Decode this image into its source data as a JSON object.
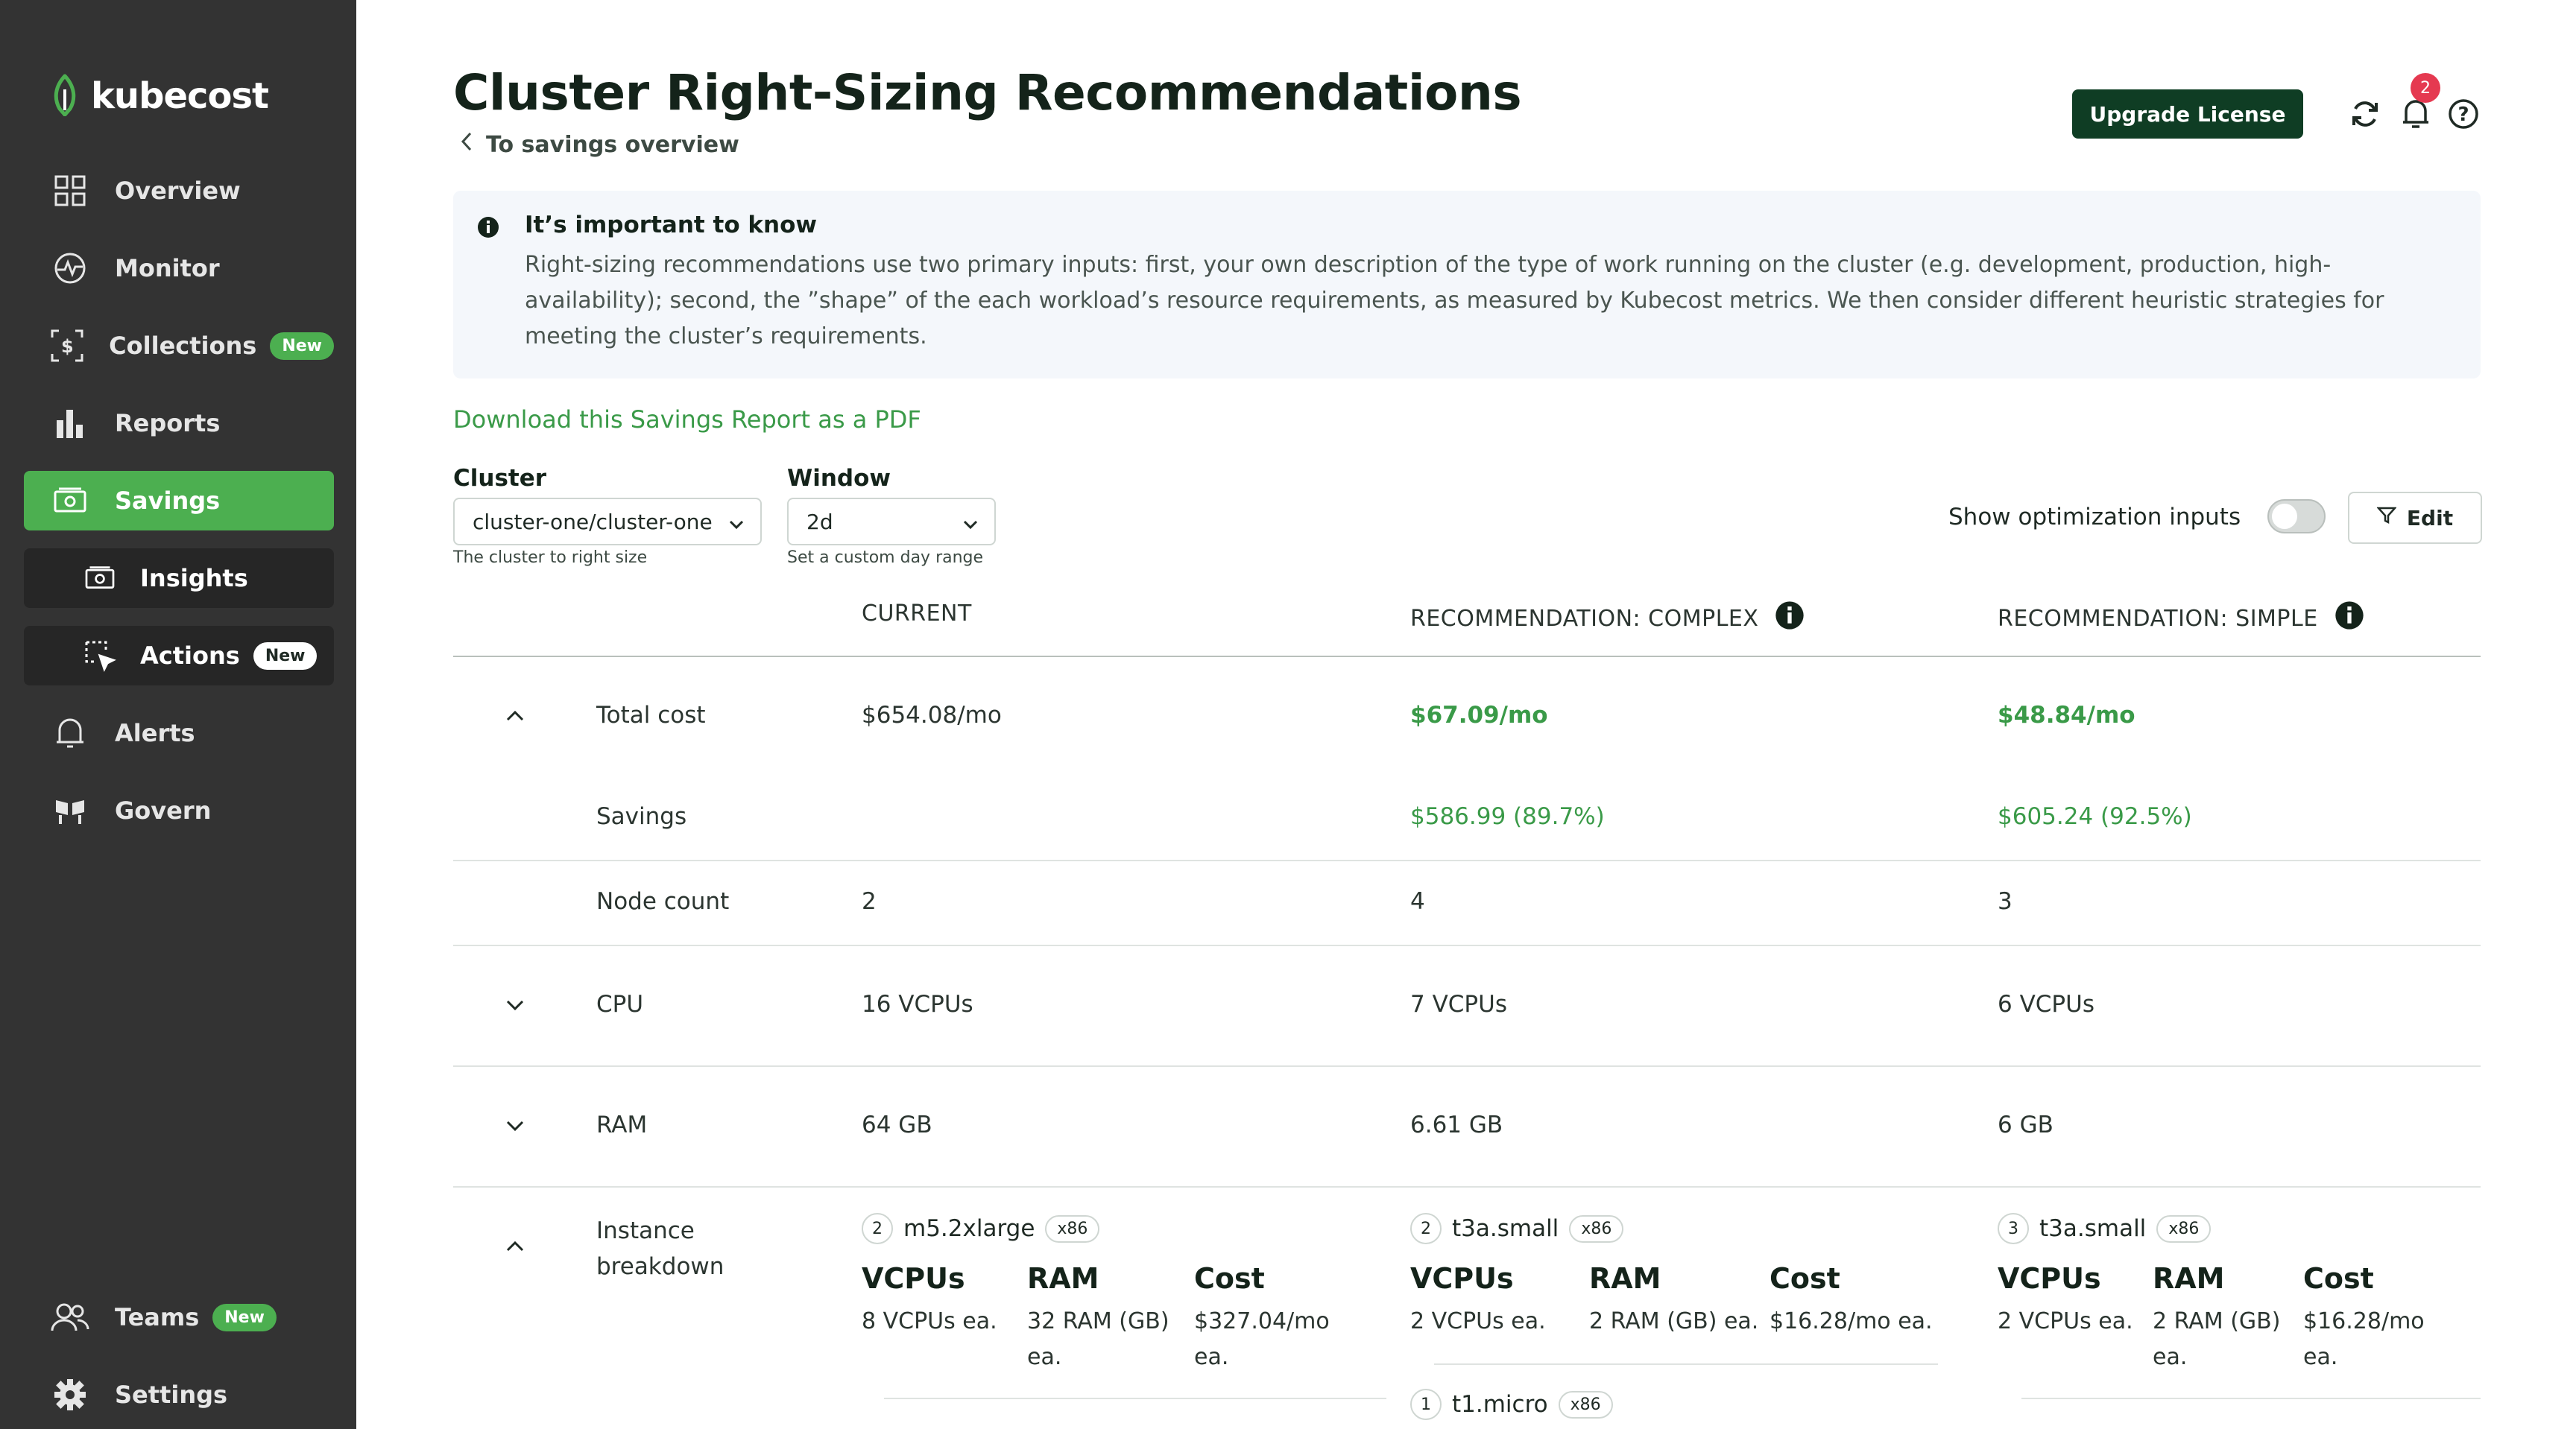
{
  "app": {
    "logo_text": "kubecost"
  },
  "sidebar": {
    "items": [
      {
        "label": "Overview"
      },
      {
        "label": "Monitor"
      },
      {
        "label": "Collections",
        "badge": "New"
      },
      {
        "label": "Reports"
      },
      {
        "label": "Savings",
        "active": true
      },
      {
        "label": "Insights"
      },
      {
        "label": "Actions",
        "badge": "New"
      },
      {
        "label": "Alerts"
      },
      {
        "label": "Govern"
      },
      {
        "label": "Teams",
        "badge": "New"
      },
      {
        "label": "Settings"
      }
    ]
  },
  "header": {
    "title": "Cluster Right-Sizing Recommendations",
    "back_label": "To savings overview",
    "upgrade_label": "Upgrade License",
    "notification_count": "2"
  },
  "info": {
    "title": "It’s important to know",
    "body": "Right-sizing recommendations use two primary inputs: first, your own description of the type of work running on the cluster (e.g. development, production, high-availability); second, the ”shape” of the each workload’s resource requirements, as measured by Kubecost metrics. We then consider different heuristic strategies for meeting the cluster’s requirements."
  },
  "download_label": "Download this Savings Report as a PDF",
  "filters": {
    "cluster": {
      "label": "Cluster",
      "value": "cluster-one/cluster-one",
      "help": "The cluster to right size"
    },
    "window": {
      "label": "Window",
      "value": "2d",
      "help": "Set a custom day range"
    },
    "optimization_label": "Show optimization inputs",
    "edit_label": "Edit"
  },
  "table": {
    "columns": [
      "CURRENT",
      "RECOMMENDATION: COMPLEX",
      "RECOMMENDATION: SIMPLE"
    ],
    "rows": {
      "total_cost": {
        "label": "Total cost",
        "current": "$654.08/mo",
        "complex": "$67.09/mo",
        "simple": "$48.84/mo"
      },
      "savings": {
        "label": "Savings",
        "current": "",
        "complex": "$586.99 (89.7%)",
        "simple": "$605.24 (92.5%)"
      },
      "node_count": {
        "label": "Node count",
        "current": "2",
        "complex": "4",
        "simple": "3"
      },
      "cpu": {
        "label": "CPU",
        "current": "16 VCPUs",
        "complex": "7 VCPUs",
        "simple": "6 VCPUs"
      },
      "ram": {
        "label": "RAM",
        "current": "64 GB",
        "complex": "6.61 GB",
        "simple": "6 GB"
      },
      "instance": {
        "label": "Instance breakdown"
      }
    },
    "spec_headers": {
      "vcpus": "VCPUs",
      "ram": "RAM",
      "cost": "Cost"
    },
    "instances": {
      "current": [
        {
          "qty": "2",
          "type": "m5.2xlarge",
          "arch": "x86",
          "vcpus": "8 VCPUs ea.",
          "ram": "32 RAM (GB) ea.",
          "cost": "$327.04/mo ea."
        }
      ],
      "complex": [
        {
          "qty": "2",
          "type": "t3a.small",
          "arch": "x86",
          "vcpus": "2 VCPUs ea.",
          "ram": "2 RAM (GB) ea.",
          "cost": "$16.28/mo ea."
        },
        {
          "qty": "1",
          "type": "t1.micro",
          "arch": "x86"
        }
      ],
      "simple": [
        {
          "qty": "3",
          "type": "t3a.small",
          "arch": "x86",
          "vcpus": "2 VCPUs ea.",
          "ram": "2 RAM (GB) ea.",
          "cost": "$16.28/mo ea."
        }
      ]
    }
  },
  "colors": {
    "sidebar_bg": "#333333",
    "accent_green": "#4caf50",
    "upgrade_bg": "#0f3d24",
    "notification_red": "#e53950",
    "savings_green": "#3a9a48"
  }
}
